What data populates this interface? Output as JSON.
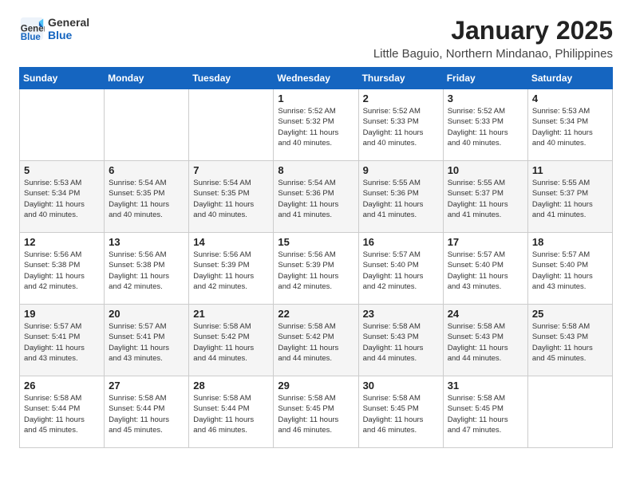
{
  "logo": {
    "general": "General",
    "blue": "Blue"
  },
  "title": "January 2025",
  "location": "Little Baguio, Northern Mindanao, Philippines",
  "days_of_week": [
    "Sunday",
    "Monday",
    "Tuesday",
    "Wednesday",
    "Thursday",
    "Friday",
    "Saturday"
  ],
  "weeks": [
    [
      {
        "day": "",
        "info": ""
      },
      {
        "day": "",
        "info": ""
      },
      {
        "day": "",
        "info": ""
      },
      {
        "day": "1",
        "info": "Sunrise: 5:52 AM\nSunset: 5:32 PM\nDaylight: 11 hours\nand 40 minutes."
      },
      {
        "day": "2",
        "info": "Sunrise: 5:52 AM\nSunset: 5:33 PM\nDaylight: 11 hours\nand 40 minutes."
      },
      {
        "day": "3",
        "info": "Sunrise: 5:52 AM\nSunset: 5:33 PM\nDaylight: 11 hours\nand 40 minutes."
      },
      {
        "day": "4",
        "info": "Sunrise: 5:53 AM\nSunset: 5:34 PM\nDaylight: 11 hours\nand 40 minutes."
      }
    ],
    [
      {
        "day": "5",
        "info": "Sunrise: 5:53 AM\nSunset: 5:34 PM\nDaylight: 11 hours\nand 40 minutes."
      },
      {
        "day": "6",
        "info": "Sunrise: 5:54 AM\nSunset: 5:35 PM\nDaylight: 11 hours\nand 40 minutes."
      },
      {
        "day": "7",
        "info": "Sunrise: 5:54 AM\nSunset: 5:35 PM\nDaylight: 11 hours\nand 40 minutes."
      },
      {
        "day": "8",
        "info": "Sunrise: 5:54 AM\nSunset: 5:36 PM\nDaylight: 11 hours\nand 41 minutes."
      },
      {
        "day": "9",
        "info": "Sunrise: 5:55 AM\nSunset: 5:36 PM\nDaylight: 11 hours\nand 41 minutes."
      },
      {
        "day": "10",
        "info": "Sunrise: 5:55 AM\nSunset: 5:37 PM\nDaylight: 11 hours\nand 41 minutes."
      },
      {
        "day": "11",
        "info": "Sunrise: 5:55 AM\nSunset: 5:37 PM\nDaylight: 11 hours\nand 41 minutes."
      }
    ],
    [
      {
        "day": "12",
        "info": "Sunrise: 5:56 AM\nSunset: 5:38 PM\nDaylight: 11 hours\nand 42 minutes."
      },
      {
        "day": "13",
        "info": "Sunrise: 5:56 AM\nSunset: 5:38 PM\nDaylight: 11 hours\nand 42 minutes."
      },
      {
        "day": "14",
        "info": "Sunrise: 5:56 AM\nSunset: 5:39 PM\nDaylight: 11 hours\nand 42 minutes."
      },
      {
        "day": "15",
        "info": "Sunrise: 5:56 AM\nSunset: 5:39 PM\nDaylight: 11 hours\nand 42 minutes."
      },
      {
        "day": "16",
        "info": "Sunrise: 5:57 AM\nSunset: 5:40 PM\nDaylight: 11 hours\nand 42 minutes."
      },
      {
        "day": "17",
        "info": "Sunrise: 5:57 AM\nSunset: 5:40 PM\nDaylight: 11 hours\nand 43 minutes."
      },
      {
        "day": "18",
        "info": "Sunrise: 5:57 AM\nSunset: 5:40 PM\nDaylight: 11 hours\nand 43 minutes."
      }
    ],
    [
      {
        "day": "19",
        "info": "Sunrise: 5:57 AM\nSunset: 5:41 PM\nDaylight: 11 hours\nand 43 minutes."
      },
      {
        "day": "20",
        "info": "Sunrise: 5:57 AM\nSunset: 5:41 PM\nDaylight: 11 hours\nand 43 minutes."
      },
      {
        "day": "21",
        "info": "Sunrise: 5:58 AM\nSunset: 5:42 PM\nDaylight: 11 hours\nand 44 minutes."
      },
      {
        "day": "22",
        "info": "Sunrise: 5:58 AM\nSunset: 5:42 PM\nDaylight: 11 hours\nand 44 minutes."
      },
      {
        "day": "23",
        "info": "Sunrise: 5:58 AM\nSunset: 5:43 PM\nDaylight: 11 hours\nand 44 minutes."
      },
      {
        "day": "24",
        "info": "Sunrise: 5:58 AM\nSunset: 5:43 PM\nDaylight: 11 hours\nand 44 minutes."
      },
      {
        "day": "25",
        "info": "Sunrise: 5:58 AM\nSunset: 5:43 PM\nDaylight: 11 hours\nand 45 minutes."
      }
    ],
    [
      {
        "day": "26",
        "info": "Sunrise: 5:58 AM\nSunset: 5:44 PM\nDaylight: 11 hours\nand 45 minutes."
      },
      {
        "day": "27",
        "info": "Sunrise: 5:58 AM\nSunset: 5:44 PM\nDaylight: 11 hours\nand 45 minutes."
      },
      {
        "day": "28",
        "info": "Sunrise: 5:58 AM\nSunset: 5:44 PM\nDaylight: 11 hours\nand 46 minutes."
      },
      {
        "day": "29",
        "info": "Sunrise: 5:58 AM\nSunset: 5:45 PM\nDaylight: 11 hours\nand 46 minutes."
      },
      {
        "day": "30",
        "info": "Sunrise: 5:58 AM\nSunset: 5:45 PM\nDaylight: 11 hours\nand 46 minutes."
      },
      {
        "day": "31",
        "info": "Sunrise: 5:58 AM\nSunset: 5:45 PM\nDaylight: 11 hours\nand 47 minutes."
      },
      {
        "day": "",
        "info": ""
      }
    ]
  ]
}
